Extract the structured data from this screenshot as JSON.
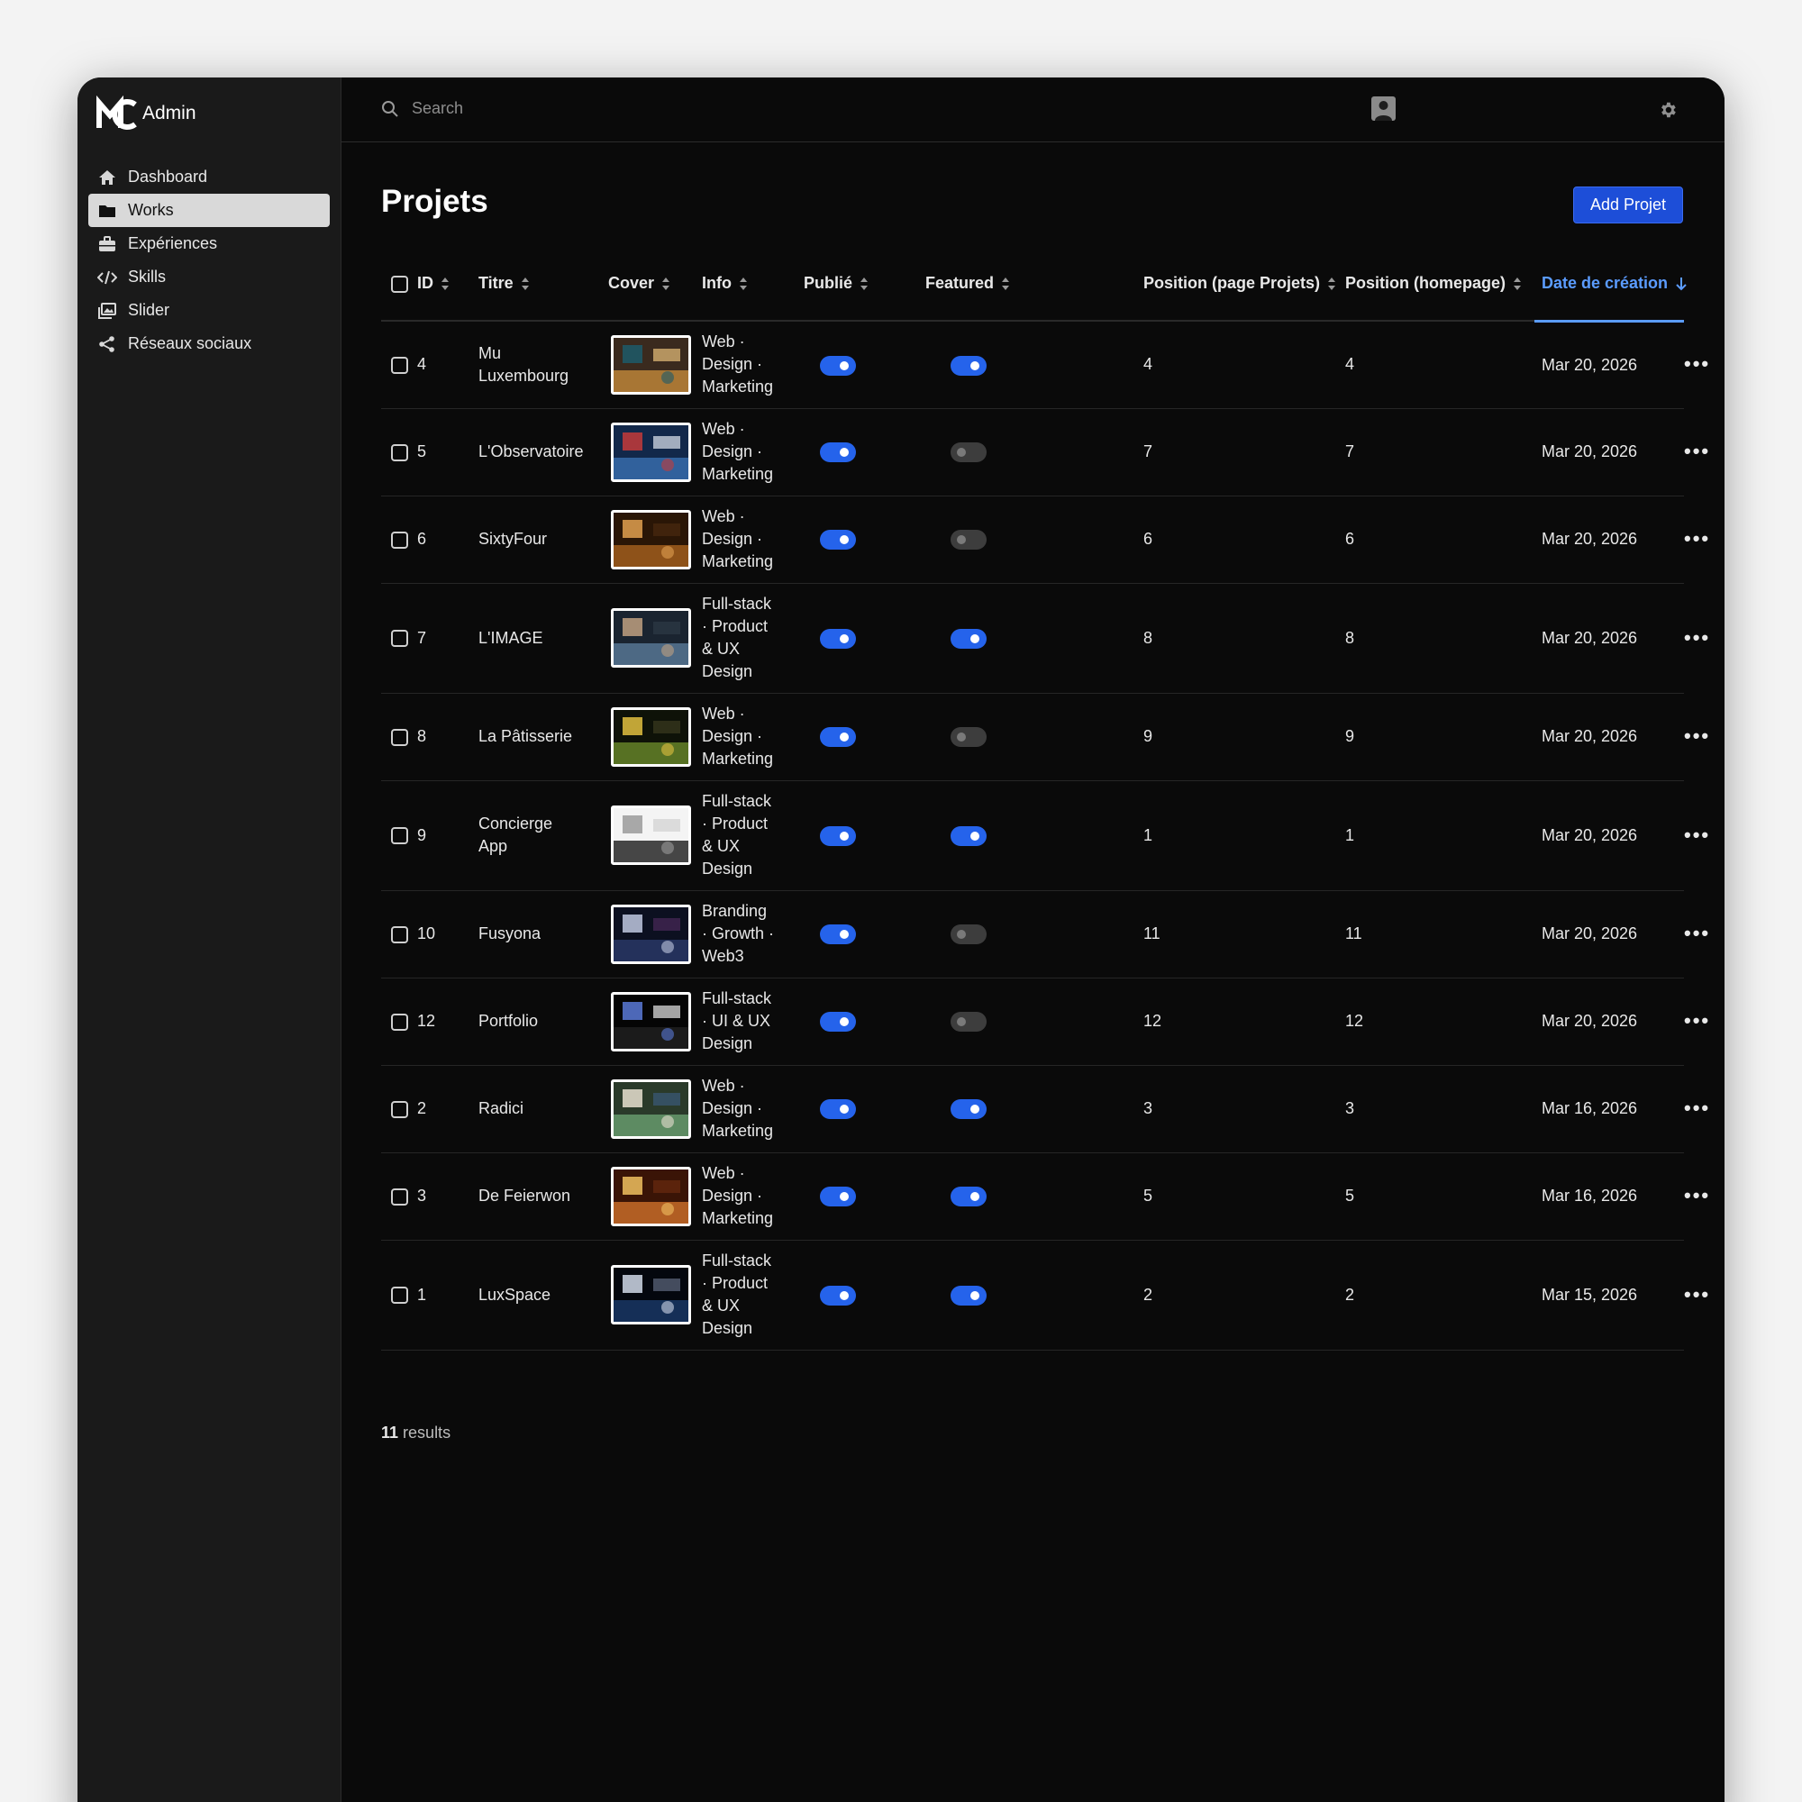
{
  "app": {
    "brand": "Admin"
  },
  "sidebar": {
    "items": [
      {
        "label": "Dashboard",
        "icon": "home-icon",
        "active": false
      },
      {
        "label": "Works",
        "icon": "folder-icon",
        "active": true
      },
      {
        "label": "Expériences",
        "icon": "briefcase-icon",
        "active": false
      },
      {
        "label": "Skills",
        "icon": "code-icon",
        "active": false
      },
      {
        "label": "Slider",
        "icon": "images-icon",
        "active": false
      },
      {
        "label": "Réseaux sociaux",
        "icon": "share-icon",
        "active": false
      }
    ]
  },
  "topbar": {
    "search_placeholder": "Search"
  },
  "page": {
    "title": "Projets",
    "add_button": "Add Projet"
  },
  "table": {
    "columns": [
      "ID",
      "Titre",
      "Cover",
      "Info",
      "Publié",
      "Featured",
      "Position (page Projets)",
      "Position (homepage)",
      "Date de création"
    ],
    "sorted_column": "Date de création",
    "rows": [
      {
        "id": "4",
        "title": [
          "Mu",
          "Luxembourg"
        ],
        "info": [
          "Web ·",
          "Design ·",
          "Marketing"
        ],
        "publie": true,
        "featured": true,
        "pos_projets": "4",
        "pos_home": "4",
        "date": "Mar 20, 2026"
      },
      {
        "id": "5",
        "title": [
          "L'Observatoire"
        ],
        "info": [
          "Web ·",
          "Design ·",
          "Marketing"
        ],
        "publie": true,
        "featured": false,
        "pos_projets": "7",
        "pos_home": "7",
        "date": "Mar 20, 2026"
      },
      {
        "id": "6",
        "title": [
          "SixtyFour"
        ],
        "info": [
          "Web ·",
          "Design ·",
          "Marketing"
        ],
        "publie": true,
        "featured": false,
        "pos_projets": "6",
        "pos_home": "6",
        "date": "Mar 20, 2026"
      },
      {
        "id": "7",
        "title": [
          "L'IMAGE"
        ],
        "info": [
          "Full-stack",
          "· Product",
          "& UX",
          "Design"
        ],
        "publie": true,
        "featured": true,
        "pos_projets": "8",
        "pos_home": "8",
        "date": "Mar 20, 2026"
      },
      {
        "id": "8",
        "title": [
          "La Pâtisserie"
        ],
        "info": [
          "Web ·",
          "Design ·",
          "Marketing"
        ],
        "publie": true,
        "featured": false,
        "pos_projets": "9",
        "pos_home": "9",
        "date": "Mar 20, 2026"
      },
      {
        "id": "9",
        "title": [
          "Concierge",
          "App"
        ],
        "info": [
          "Full-stack",
          "· Product",
          "& UX",
          "Design"
        ],
        "publie": true,
        "featured": true,
        "pos_projets": "1",
        "pos_home": "1",
        "date": "Mar 20, 2026"
      },
      {
        "id": "10",
        "title": [
          "Fusyona"
        ],
        "info": [
          "Branding",
          "· Growth ·",
          "Web3"
        ],
        "publie": true,
        "featured": false,
        "pos_projets": "11",
        "pos_home": "11",
        "date": "Mar 20, 2026"
      },
      {
        "id": "12",
        "title": [
          "Portfolio"
        ],
        "info": [
          "Full-stack",
          "· UI & UX",
          "Design"
        ],
        "publie": true,
        "featured": false,
        "pos_projets": "12",
        "pos_home": "12",
        "date": "Mar 20, 2026"
      },
      {
        "id": "2",
        "title": [
          "Radici"
        ],
        "info": [
          "Web ·",
          "Design ·",
          "Marketing"
        ],
        "publie": true,
        "featured": true,
        "pos_projets": "3",
        "pos_home": "3",
        "date": "Mar 16, 2026"
      },
      {
        "id": "3",
        "title": [
          "De Feierwon"
        ],
        "info": [
          "Web ·",
          "Design ·",
          "Marketing"
        ],
        "publie": true,
        "featured": true,
        "pos_projets": "5",
        "pos_home": "5",
        "date": "Mar 16, 2026"
      },
      {
        "id": "1",
        "title": [
          "LuxSpace"
        ],
        "info": [
          "Full-stack",
          "· Product",
          "& UX",
          "Design"
        ],
        "publie": true,
        "featured": true,
        "pos_projets": "2",
        "pos_home": "2",
        "date": "Mar 15, 2026"
      }
    ]
  },
  "footer": {
    "count": "11",
    "label": "results"
  },
  "colors": {
    "accent": "#2563eb",
    "sorted_header": "#5b9cff",
    "background": "#0a0a0a",
    "sidebar": "#1a1a1a"
  }
}
